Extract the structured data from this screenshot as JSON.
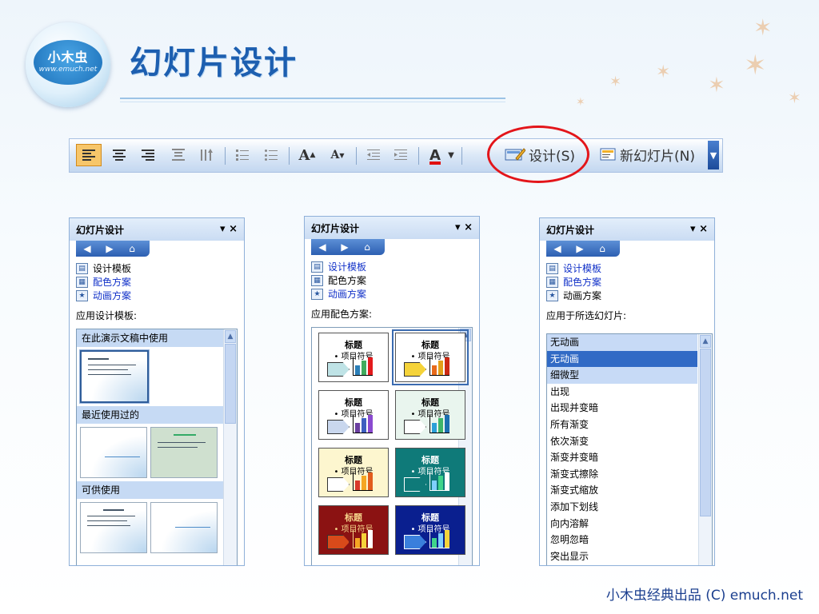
{
  "logo": {
    "line1": "小木虫",
    "line2": "www.emuch.net"
  },
  "title": "幻灯片设计",
  "toolbar": {
    "design_label": "设计(S)",
    "new_slide_label": "新幻灯片(N)",
    "font_big": "A",
    "font_small": "A",
    "font_color": "A"
  },
  "pane_title": "幻灯片设计",
  "pane_links": [
    "设计模板",
    "配色方案",
    "动画方案"
  ],
  "pane1": {
    "section": "应用设计模板:",
    "groups": [
      "在此演示文稿中使用",
      "最近使用过的",
      "可供使用"
    ]
  },
  "pane2": {
    "section": "应用配色方案:",
    "scheme_title": "标题",
    "scheme_bullet": "• 项目符号",
    "schemes": [
      {
        "bg": "#ffffff",
        "fg": "#000000",
        "arrow": "#bfe3e6",
        "bars": [
          "#2c7fb8",
          "#41ab5d",
          "#e31a1c"
        ]
      },
      {
        "bg": "#ffffff",
        "fg": "#000000",
        "arrow": "#f5d33a",
        "bars": [
          "#e86a1b",
          "#e3a018",
          "#cc2a14"
        ]
      },
      {
        "bg": "#ffffff",
        "fg": "#000000",
        "arrow": "#c9d7ee",
        "bars": [
          "#6b3fa0",
          "#3e5fc0",
          "#8a4ad0"
        ]
      },
      {
        "bg": "#e9f5ee",
        "fg": "#000000",
        "arrow": "#ffffff",
        "bars": [
          "#2b9fd8",
          "#3fb56a",
          "#1c6fb0"
        ]
      },
      {
        "bg": "#fdf6cf",
        "fg": "#000000",
        "arrow": "#ffffff",
        "bars": [
          "#d93a2a",
          "#f5a623",
          "#e25c1d"
        ]
      },
      {
        "bg": "#0f7a79",
        "fg": "#ffffff",
        "arrow": "#0f7a79",
        "bars": [
          "#7fd0ff",
          "#3fd48a",
          "#ffffff"
        ]
      },
      {
        "bg": "#8b1212",
        "fg": "#f5d48a",
        "arrow": "#d84a1a",
        "bars": [
          "#f5a623",
          "#f5d33a",
          "#ffffff"
        ]
      },
      {
        "bg": "#0a1f8f",
        "fg": "#ffffff",
        "arrow": "#3a7fdc",
        "bars": [
          "#3fd48a",
          "#7fd0ff",
          "#f5d33a"
        ]
      }
    ]
  },
  "pane3": {
    "section": "应用于所选幻灯片:",
    "current": "无动画",
    "items": [
      "无动画",
      "细微型",
      "出现",
      "出现并变暗",
      "所有渐变",
      "依次渐变",
      "渐变并变暗",
      "渐变式擦除",
      "渐变式缩放",
      "添加下划线",
      "向内溶解",
      "忽明忽暗",
      "突出显示"
    ]
  },
  "footer": "小木虫经典出品 (C) emuch.net"
}
